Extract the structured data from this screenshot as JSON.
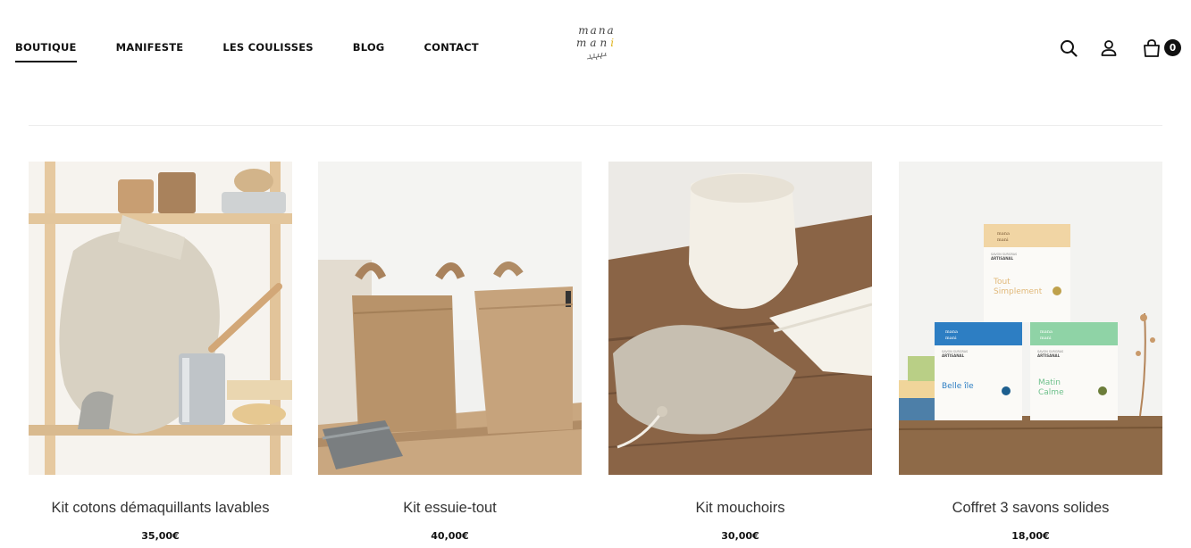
{
  "nav": {
    "items": [
      {
        "label": "BOUTIQUE",
        "active": true
      },
      {
        "label": "MANIFESTE"
      },
      {
        "label": "LES COULISSES"
      },
      {
        "label": "BLOG"
      },
      {
        "label": "CONTACT"
      }
    ]
  },
  "logo": {
    "line1": "mana",
    "line2a": "man",
    "line2b": "i"
  },
  "header": {
    "cart_count": "0"
  },
  "products": [
    {
      "title": "Kit cotons démaquillants lavables",
      "price": "35,00€"
    },
    {
      "title": "Kit essuie-tout",
      "price": "40,00€"
    },
    {
      "title": "Kit mouchoirs",
      "price": "30,00€"
    },
    {
      "title": "Coffret 3 savons solides",
      "price": "18,00€"
    }
  ],
  "packaging": {
    "top_box": {
      "brand_l1": "mana",
      "brand_l2": "mani",
      "tagline_l1": "SAVON SURGRAS",
      "tagline_l2": "ARTISANAL",
      "name_l1": "Tout",
      "name_l2": "Simplement"
    },
    "left_box": {
      "brand_l1": "mana",
      "brand_l2": "mani",
      "tagline_l1": "SAVON SURGRAS",
      "tagline_l2": "ARTISANAL",
      "name": "Belle île"
    },
    "right_box": {
      "brand_l1": "mana",
      "brand_l2": "mani",
      "tagline_l1": "SAVON SURGRAS",
      "tagline_l2": "ARTISANAL",
      "name_l1": "Matin",
      "name_l2": "Calme"
    }
  },
  "colors": {
    "accent": "#111111",
    "logo_dot": "#e0b520",
    "divider": "#ececec"
  },
  "icons": [
    "search-icon",
    "account-icon",
    "cart-icon"
  ]
}
